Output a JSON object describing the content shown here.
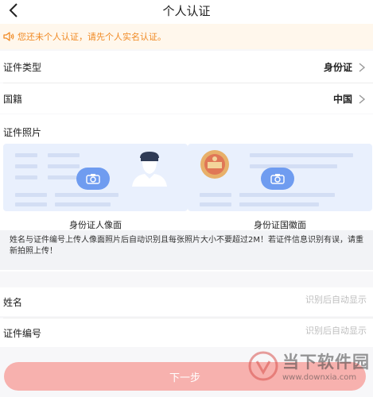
{
  "header": {
    "title": "个人认证"
  },
  "notice": {
    "text": "您还未个人认证，请先个人实名认证。"
  },
  "id_type": {
    "label": "证件类型",
    "value": "身份证"
  },
  "nationality": {
    "label": "国籍",
    "value": "中国"
  },
  "photos": {
    "title": "证件照片",
    "front_caption": "身份证人像面",
    "back_caption": "身份证国徽面"
  },
  "hint": "姓名与证件编号上传人像面照片后自动识别且每张照片大小不要超过2M！若证件信息识别有误，请重新拍照上传！",
  "fields": {
    "name": {
      "label": "姓名",
      "placeholder": "识别后自动显示"
    },
    "id_number": {
      "label": "证件编号",
      "placeholder": "识别后自动显示"
    }
  },
  "next_button": "下一步",
  "watermark": {
    "text": "当下软件园",
    "url": "www.downxia.com"
  },
  "colors": {
    "notice_text": "#f08a24",
    "notice_bg": "#fff7ec",
    "accent_blue": "#6f9cf0",
    "button": "#f7b1ae"
  }
}
